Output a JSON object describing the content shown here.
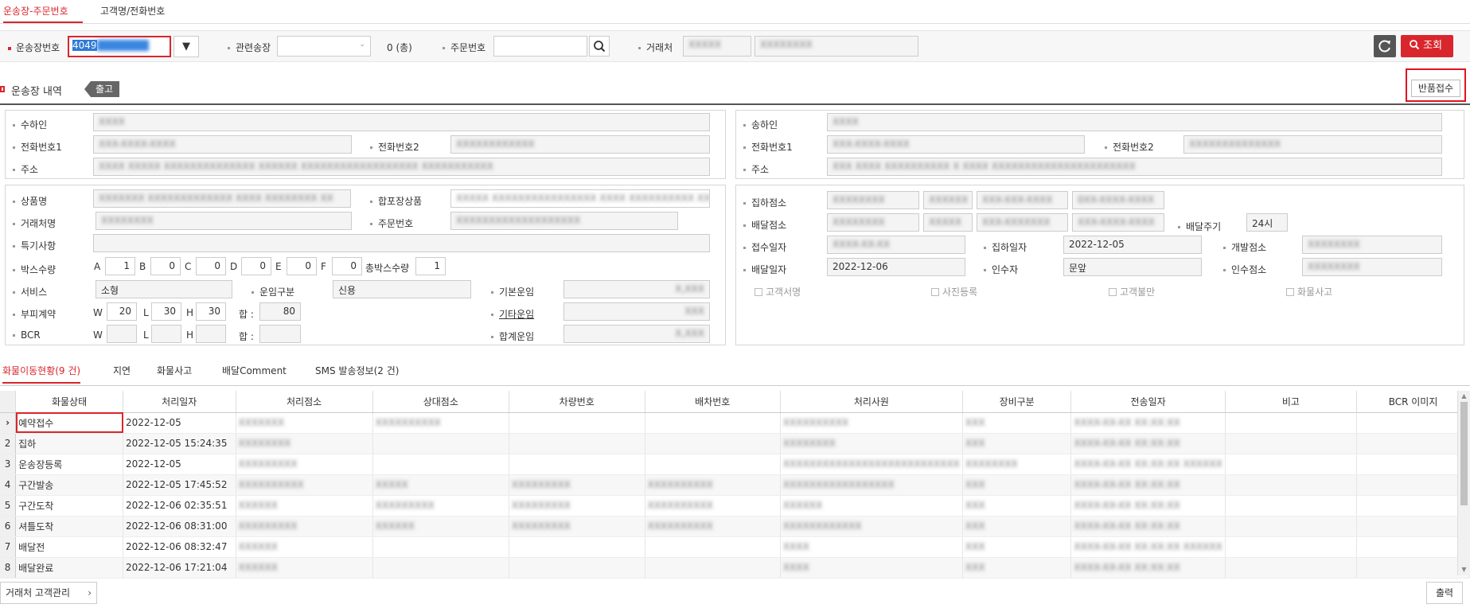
{
  "top_tabs": [
    "운송장-주문번호",
    "고객명/전화번호"
  ],
  "search": {
    "waybill_label": "운송장번호",
    "waybill_value": "4049",
    "related_label": "관련송장",
    "related_count": "0 (총)",
    "order_label": "주문번호",
    "partner_label": "거래처",
    "partner_code": "XXXXX",
    "partner_name": "XXXXXXXX",
    "query_label": "조회"
  },
  "section": {
    "title": "운송장 내역",
    "badge": "출고",
    "return_button": "반품접수"
  },
  "receiver": {
    "name_label": "수하인",
    "name": "XXXX",
    "tel1_label": "전화번호1",
    "tel1": "XXX-XXXX-XXXX",
    "tel2_label": "전화번호2",
    "tel2": "XXXXXXXXXXXX",
    "addr_label": "주소",
    "addr": "XXXX XXXXX XXXXXXXXXXXXXX XXXXXX XXXXXXXXXXXXXXXXXX XXXXXXXXXXX"
  },
  "sender": {
    "name_label": "송하인",
    "name": "XXXX",
    "tel1_label": "전화번호1",
    "tel1": "XXX-XXXX-XXXX",
    "tel2_label": "전화번호2",
    "tel2": "XXXXXXXXXXXXXX",
    "addr_label": "주소",
    "addr": "XXX XXXX XXXXXXXXXX X XXXX XXXXXXXXXXXXXXXXXXXXXX"
  },
  "goods": {
    "product_label": "상품명",
    "product": "XXXXXXX XXXXXXXXXXXXX XXXX XXXXXXXX XX",
    "combined_label": "합포장상품",
    "combined": "XXXXX XXXXXXXXXXXXXXXX XXXX XXXXXXXXXX XX",
    "partner_label": "거래처명",
    "partner": "XXXXXXXX",
    "order_label": "주문번호",
    "order": "XXXXXXXXXXXXXXXXXXX",
    "special_label": "특기사항",
    "box_label": "박스수량",
    "box_sizes": [
      {
        "k": "A",
        "v": "1"
      },
      {
        "k": "B",
        "v": "0"
      },
      {
        "k": "C",
        "v": "0"
      },
      {
        "k": "D",
        "v": "0"
      },
      {
        "k": "E",
        "v": "0"
      },
      {
        "k": "F",
        "v": "0"
      }
    ],
    "total_box_label": "총박스수량",
    "total_box": "1",
    "service_label": "서비스",
    "service": "소형",
    "fare_type_label": "운임구분",
    "fare_type": "신용",
    "base_fare_label": "기본운임",
    "base_fare": "X,XXX",
    "volume_label": "부피계약",
    "w_label": "W",
    "w": "20",
    "l_label": "L",
    "l": "30",
    "h_label": "H",
    "h": "30",
    "sum_label": "합 :",
    "sum": "80",
    "other_fare_label": "기타운임",
    "other_fare": "XXX",
    "bcr_label": "BCR",
    "total_fare_label": "합계운임",
    "total_fare": "X,XXX"
  },
  "delivery": {
    "pickup_office_label": "집하점소",
    "pickup_office": [
      "XXXXXXXX",
      "XXXXXX",
      "XXX-XXX-XXXX",
      "0XX-XXXX-XXXX"
    ],
    "deliver_office_label": "배달점소",
    "deliver_office": [
      "XXXXXXXX",
      "XXXXX",
      "XXX-XXXXXXX",
      "XXX-XXXX-XXXX"
    ],
    "cycle_label": "배달주기",
    "cycle": "24시",
    "receipt_date_label": "접수일자",
    "receipt_date": "XXXX-XX-XX",
    "pickup_date_label": "집하일자",
    "pickup_date": "2022-12-05",
    "dev_office_label": "개발점소",
    "dev_office": "XXXXXXXX",
    "deliver_date_label": "배달일자",
    "deliver_date": "2022-12-06",
    "acceptor_label": "인수자",
    "acceptor": "문앞",
    "accept_office_label": "인수점소",
    "accept_office": "XXXXXXXX",
    "checks": [
      "고객서명",
      "사진등록",
      "고객불만",
      "화물사고"
    ]
  },
  "bottom_tabs": [
    "화물이동현황(9 건)",
    "지연",
    "화물사고",
    "배달Comment",
    "SMS 발송정보(2 건)"
  ],
  "grid": {
    "headers": [
      "화물상태",
      "처리일자",
      "처리점소",
      "상대점소",
      "차량번호",
      "배차번호",
      "처리사원",
      "장비구분",
      "전송일자",
      "비고",
      "BCR 이미지"
    ],
    "rows": [
      {
        "n": "",
        "status": "예약접수",
        "date": "2022-12-05",
        "office": "XXXXXXX",
        "peer": "XXXXXXXXXX",
        "car": "",
        "dispatch": "",
        "staff": "XXXXXXXXXX",
        "equip": "XXX",
        "sent": "XXXX-XX-XX XX:XX:XX"
      },
      {
        "n": "2",
        "status": "집하",
        "date": "2022-12-05 15:24:35",
        "office": "XXXXXXXX",
        "peer": "",
        "car": "",
        "dispatch": "",
        "staff": "XXXXXXXX",
        "equip": "XXX",
        "sent": "XXXX-XX-XX XX:XX:XX"
      },
      {
        "n": "3",
        "status": "운송장등록",
        "date": "2022-12-05",
        "office": "XXXXXXXXX",
        "peer": "",
        "car": "",
        "dispatch": "",
        "staff": "XXXXXXXXXXXXXXXXXXXXXXXXXXX",
        "equip": "XXXXXXXX",
        "sent": "XXXX-XX-XX XX:XX:XX XXXXXX"
      },
      {
        "n": "4",
        "status": "구간발송",
        "date": "2022-12-05 17:45:52",
        "office": "XXXXXXXXXX",
        "peer": "XXXXX",
        "car": "XXXXXXXXX",
        "dispatch": "XXXXXXXXXX",
        "staff": "XXXXXXXXXXXXXXXXX",
        "equip": "XXX",
        "sent": "XXXX-XX-XX XX:XX:XX"
      },
      {
        "n": "5",
        "status": "구간도착",
        "date": "2022-12-06 02:35:51",
        "office": "XXXXXX",
        "peer": "XXXXXXXXX",
        "car": "XXXXXXXXX",
        "dispatch": "XXXXXXXXXX",
        "staff": "XXXXXX",
        "equip": "XXX",
        "sent": "XXXX-XX-XX XX:XX:XX"
      },
      {
        "n": "6",
        "status": "셔틀도착",
        "date": "2022-12-06 08:31:00",
        "office": "XXXXXXXXX",
        "peer": "XXXXXX",
        "car": "XXXXXXXXX",
        "dispatch": "XXXXXXXXXX",
        "staff": "XXXXXXXXXXXX",
        "equip": "XXX",
        "sent": "XXXX-XX-XX XX:XX:XX"
      },
      {
        "n": "7",
        "status": "배달전",
        "date": "2022-12-06 08:32:47",
        "office": "XXXXXX",
        "peer": "",
        "car": "",
        "dispatch": "",
        "staff": "XXXX",
        "equip": "XXX",
        "sent": "XXXX-XX-XX XX:XX:XX XXXXXX"
      },
      {
        "n": "8",
        "status": "배달완료",
        "date": "2022-12-06 17:21:04",
        "office": "XXXXXX",
        "peer": "",
        "car": "",
        "dispatch": "",
        "staff": "XXXX",
        "equip": "XXX",
        "sent": "XXXX-XX-XX XX:XX:XX"
      }
    ]
  },
  "footer": {
    "left_button": "거래처 고객관리",
    "print_button": "출력"
  }
}
